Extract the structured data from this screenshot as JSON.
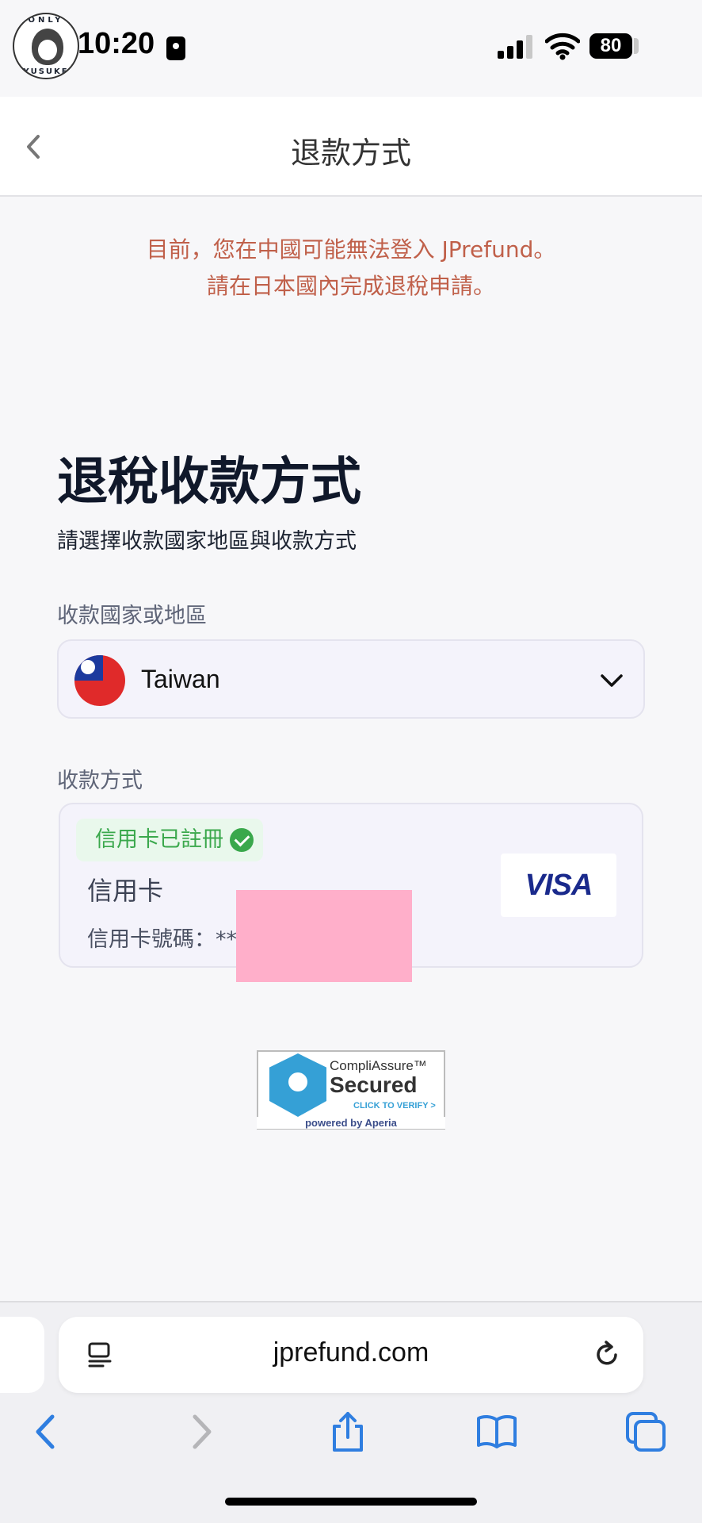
{
  "status_bar": {
    "time": "10:20",
    "battery": "80",
    "avatar_top_text": "ONLY",
    "avatar_bottom_text": "YUSUKE"
  },
  "header": {
    "title": "退款方式"
  },
  "warning": {
    "line1": "目前，您在中國可能無法登入 JPrefund。",
    "line2": "請在日本國內完成退稅申請。"
  },
  "main": {
    "title": "退稅收款方式",
    "subtitle": "請選擇收款國家地區與收款方式",
    "country_label": "收款國家或地區",
    "country_value": "Taiwan",
    "method_label": "收款方式",
    "method": {
      "badge": "信用卡已註冊",
      "name": "信用卡",
      "card_number": "信用卡號碼：**",
      "brand": "VISA"
    }
  },
  "seal": {
    "brand": "CompliAssure™",
    "secured": "Secured",
    "verify": "CLICK TO VERIFY >",
    "powered": "powered by Aperia"
  },
  "browser": {
    "url": "jprefund.com"
  },
  "colors": {
    "warning": "#c0604a",
    "badge_green": "#3aa84c",
    "visa_blue": "#1a2a8c",
    "link_blue": "#2f7ee0",
    "redaction": "#ffafca"
  }
}
